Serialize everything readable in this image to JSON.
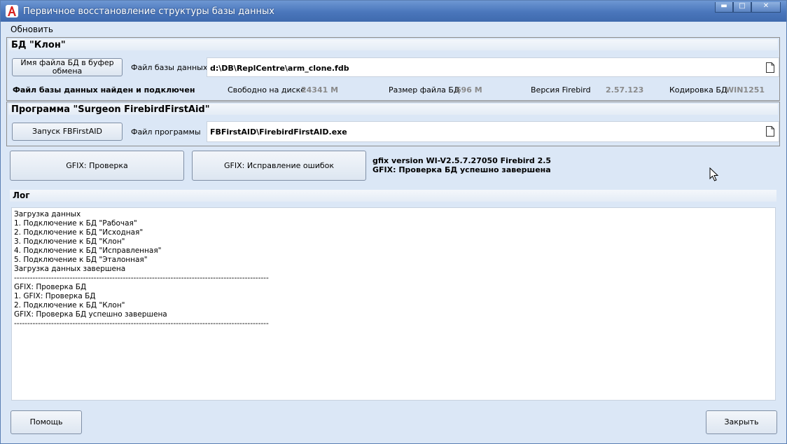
{
  "window": {
    "title": "Первичное восстановление структуры базы данных",
    "controls": {
      "minimize": "▬",
      "maximize": "□",
      "close": "✕"
    }
  },
  "menu": {
    "refresh": "Обновить"
  },
  "db_group": {
    "title": "БД \"Клон\"",
    "copy_button": "Имя файла БД в буфер обмена",
    "file_label": "Файл базы данных",
    "file_value": "d:\\DB\\ReplCentre\\arm_clone.fdb",
    "status": "Файл базы данных найден и подключен",
    "free_label": "Свободно на диске",
    "free_value": "24341 М",
    "size_label": "Размер файла  БД",
    "size_value": "696 М",
    "version_label": "Версия Firebird",
    "version_value": "2.57.123",
    "encoding_label": "Кодировка БД",
    "encoding_value": "WIN1251"
  },
  "prog_group": {
    "title": "Программа \"Surgeon FirebirdFirstAid\"",
    "run_button": "Запуск FBFirstAID",
    "file_label": "Файл программы",
    "file_value": "FBFirstAID\\FirebirdFirstAID.exe"
  },
  "gfix": {
    "check_button": "GFIX:  Проверка",
    "fix_button": "GFIX:  Исправление ошибок",
    "status_line1": "gfix version WI-V2.5.7.27050 Firebird 2.5",
    "status_line2": "GFIX: Проверка БД успешно завершена"
  },
  "log": {
    "title": "Лог",
    "lines": [
      "Загрузка данных",
      "1. Подключение к БД \"Рабочая\"",
      "2. Подключение к БД \"Исходная\"",
      "3. Подключение к БД \"Клон\"",
      "4. Подключение к БД \"Исправленная\"",
      "5. Подключение к БД \"Эталонная\"",
      "Загрузка данных завершена",
      "------------------------------------------------------------------------------------------------",
      "GFIX: Проверка БД",
      "1. GFIX: Проверка БД",
      "2. Подключение к БД \"Клон\"",
      "GFIX: Проверка БД успешно завершена",
      "------------------------------------------------------------------------------------------------"
    ]
  },
  "footer": {
    "help_button": "Помощь",
    "close_button": "Закрыть"
  },
  "colors": {
    "titlebar": "#4a76bb",
    "background": "#dbe7f6",
    "icon_red": "#d9231f"
  }
}
